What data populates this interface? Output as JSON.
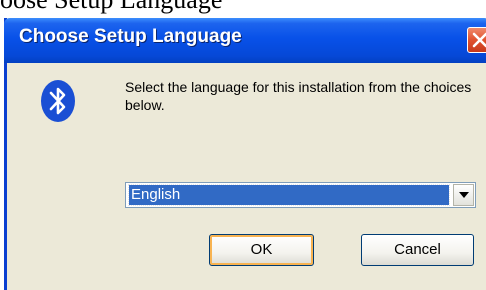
{
  "page": {
    "heading": "oose Setup Language"
  },
  "dialog": {
    "title": "Choose Setup Language",
    "message": "Select the language for this installation from the choices below.",
    "language_select": {
      "selected": "English"
    },
    "buttons": {
      "ok": "OK",
      "cancel": "Cancel"
    },
    "icons": {
      "app": "bluetooth-icon",
      "close": "close-icon",
      "dropdown": "chevron-down-icon"
    }
  },
  "colors": {
    "titlebar": "#0851e8",
    "window_body": "#ece9d8",
    "close_button": "#e0522f",
    "selection": "#316ac5",
    "bluetooth": "#1a4fd4"
  }
}
